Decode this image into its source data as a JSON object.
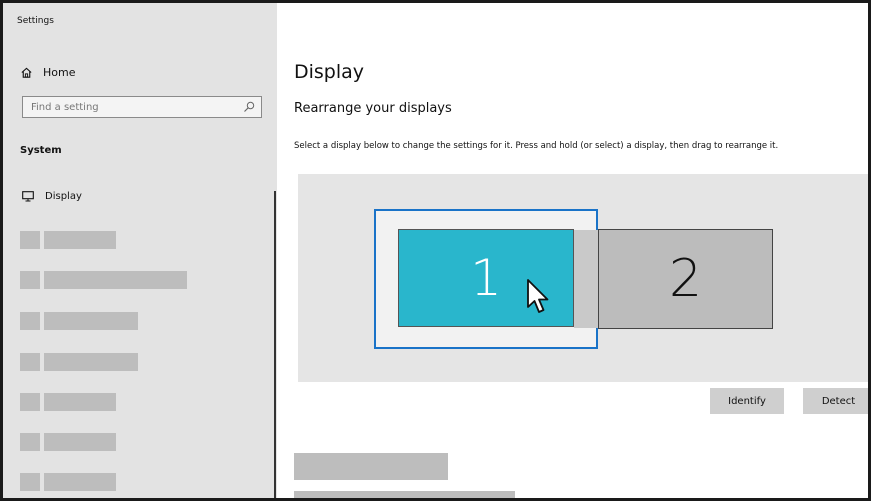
{
  "window": {
    "title": "Settings"
  },
  "sidebar": {
    "home_label": "Home",
    "search_placeholder": "Find a setting",
    "section_title": "System",
    "display_label": "Display"
  },
  "main": {
    "title": "Display",
    "subheading": "Rearrange your displays",
    "instructions": "Select a display below to change the settings for it. Press and hold (or select) a display, then drag to rearrange it.",
    "monitors": [
      {
        "label": "1",
        "selected": true,
        "color": "#29b6cc"
      },
      {
        "label": "2",
        "selected": false,
        "color": "#bcbcbc"
      }
    ],
    "identify_label": "Identify",
    "detect_label": "Detect"
  },
  "colors": {
    "accent": "#1a73c8",
    "selected_monitor": "#29b6cc",
    "sidebar_bg": "#e3e3e3"
  }
}
